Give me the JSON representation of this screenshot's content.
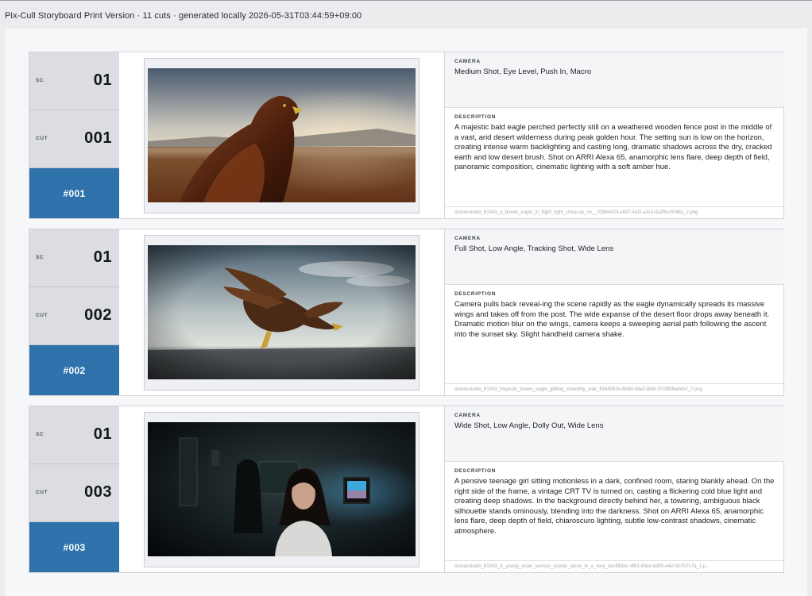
{
  "header": {
    "title": "Pix-Cull Storyboard Print Version · 11 cuts · generated locally 2026-05-31T03:44:59+09:00"
  },
  "labels": {
    "sc": "SC",
    "cut": "CUT",
    "camera": "CAMERA",
    "description": "DESCRIPTION"
  },
  "cuts": [
    {
      "sc": "01",
      "cut": "001",
      "id": "#001",
      "camera": "Medium Shot, Eye Level, Push In, Macro",
      "description": "A majestic bald eagle perched perfectly still on a weathered wooden fence post in the middle of a vast, arid desert wilderness during peak golden hour. The setting sun is low on the horizon, creating intense warm backlighting and casting long, dramatic shadows across the dry, cracked earth and low desert brush. Shot on ARRI Alexa 65, anamorphic lens flare, deep depth of field, panoramic composition, cinematic lighting with a soft amber hue.",
      "filename": "stonevstudio_61043_a_brown_eagle_in_flight_tight_close-up_on__02884003-e8d7-4af2-a114-da3fbcc506fa_2.png"
    },
    {
      "sc": "01",
      "cut": "002",
      "id": "#002",
      "camera": "Full Shot, Low Angle, Tracking Shot, Wide Lens",
      "description": "Camera pulls back reveal-ing the scene rapidly as the eagle dynamically spreads its massive wings and takes off from the post. The wide expanse of the desert floor drops away beneath it. Dramatic motion blur on the wings, camera keeps a sweeping aerial path following the ascent into the sunset sky. Slight handheld camera shake.",
      "filename": "stonevstudio_61043_majestic_brown_eagle_gliding_smoothly_side_5944091e-6b8d-48a3-bbfd-37cf908ade52_2.png"
    },
    {
      "sc": "01",
      "cut": "003",
      "id": "#003",
      "camera": "Wide Shot, Low Angle, Dolly Out, Wide Lens",
      "description": "A pensive teenage girl sitting motionless in a dark, confined room, staring blankly ahead. On the right side of the frame, a vintage CRT TV is turned on, casting a flickering cold blue light and creating deep shadows. In the background directly behind her, a towering, ambiguous black silhouette stands ominously, blending into the darkness. Shot on ARRI Alexa 65, anamorphic lens flare, deep depth of field, chiaroscuro lighting, subtle low-contrast shadows, cinematic atmosphere.",
      "filename": "stonevstudio_61043_A_young_asian_woman_stands_alone_in_a_very_3ec693ec-4fb3-43ad-bd55-e4e7dc707c7a_1.p..."
    }
  ]
}
